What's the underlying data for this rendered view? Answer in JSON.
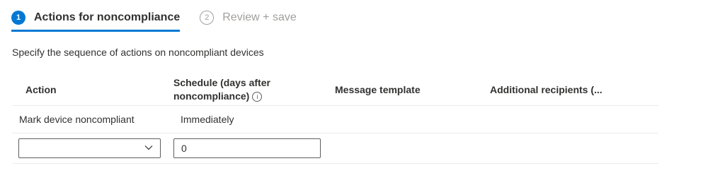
{
  "wizard": {
    "steps": [
      {
        "number": "1",
        "label": "Actions for noncompliance",
        "active": true
      },
      {
        "number": "2",
        "label": "Review + save",
        "active": false
      }
    ]
  },
  "description": "Specify the sequence of actions on noncompliant devices",
  "table": {
    "headers": {
      "action": "Action",
      "schedule_line1": "Schedule (days after",
      "schedule_line2": "noncompliance)",
      "message": "Message template",
      "recipients": "Additional recipients (..."
    },
    "rows": [
      {
        "action": "Mark device noncompliant",
        "schedule": "Immediately",
        "message": "",
        "recipients": ""
      }
    ],
    "new_row": {
      "action_selected": "",
      "schedule_value": "0"
    }
  },
  "icons": {
    "info": "info-icon",
    "dropdown": "chevron-down-icon"
  },
  "colors": {
    "accent": "#0078d4",
    "inactive": "#a19f9d",
    "text": "#323130",
    "border": "#605e5c",
    "divider": "#edebe9"
  }
}
